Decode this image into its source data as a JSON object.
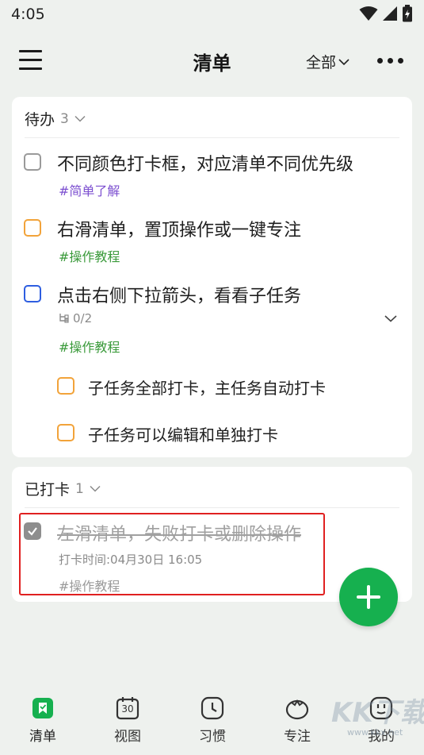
{
  "status_bar": {
    "time": "4:05"
  },
  "header": {
    "title": "清单",
    "filter_label": "全部"
  },
  "todo_section": {
    "title": "待办",
    "count": "3",
    "tasks": [
      {
        "text": "不同颜色打卡框，对应清单不同优先级",
        "tag": "#简单了解",
        "checkbox_color": "gray"
      },
      {
        "text": "右滑清单，置顶操作或一键专注",
        "tag": "#操作教程",
        "checkbox_color": "orange"
      },
      {
        "text": "点击右侧下拉箭头，看看子任务",
        "subtask_progress": "0/2",
        "tag": "#操作教程",
        "checkbox_color": "blue",
        "subtasks": [
          {
            "text": "子任务全部打卡，主任务自动打卡"
          },
          {
            "text": "子任务可以编辑和单独打卡"
          }
        ]
      }
    ]
  },
  "done_section": {
    "title": "已打卡",
    "count": "1",
    "tasks": [
      {
        "text": "左滑清单，失败打卡或删除操作",
        "checkin_time": "打卡时间:04月30日 16:05",
        "tag": "#操作教程"
      }
    ]
  },
  "bottom_nav": [
    {
      "label": "清单",
      "icon": "checklist-icon",
      "active": true
    },
    {
      "label": "视图",
      "icon": "calendar-icon",
      "calendar_day": "30"
    },
    {
      "label": "习惯",
      "icon": "clock-icon"
    },
    {
      "label": "专注",
      "icon": "tomato-icon"
    },
    {
      "label": "我的",
      "icon": "profile-face-icon"
    }
  ],
  "watermark": {
    "text": "KK下载",
    "url": "www.kkx.net"
  },
  "colors": {
    "accent": "#16b04f",
    "highlight_border": "#e02020",
    "priority_orange": "#f2a33a",
    "priority_blue": "#2e5ee0",
    "tag_purple": "#7c4fd0",
    "tag_green": "#3a9a3a"
  }
}
